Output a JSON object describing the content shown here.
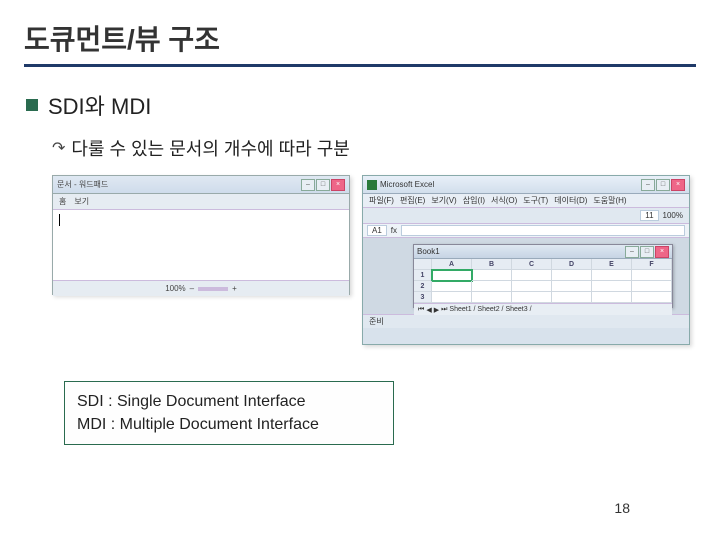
{
  "slide": {
    "title": "도큐먼트/뷰 구조",
    "section_heading": "SDI와 MDI",
    "sub_point": "다룰 수 있는 문서의 개수에 따라 구분",
    "page_number": "18"
  },
  "definitions": {
    "sdi": "SDI : Single Document Interface",
    "mdi": "MDI : Multiple Document Interface"
  },
  "sdi_app": {
    "title": "문서 - 워드패드",
    "toolbar_items": [
      "홈",
      "보기"
    ],
    "zoom_label": "100%"
  },
  "mdi_app": {
    "app_name": "Microsoft Excel",
    "menus": [
      "파일(F)",
      "편집(E)",
      "보기(V)",
      "삽입(I)",
      "서식(O)",
      "도구(T)",
      "데이터(D)",
      "도움말(H)"
    ],
    "font_size": "11",
    "zoom": "100%",
    "cell_ref": "A1",
    "fx_label": "fx",
    "child_doc": "Book1",
    "columns": [
      "A",
      "B",
      "C",
      "D",
      "E",
      "F"
    ],
    "rows": [
      "1",
      "2",
      "3"
    ],
    "sheet_tabs": "Sheet1 / Sheet2 / Sheet3 /",
    "status": "준비"
  }
}
